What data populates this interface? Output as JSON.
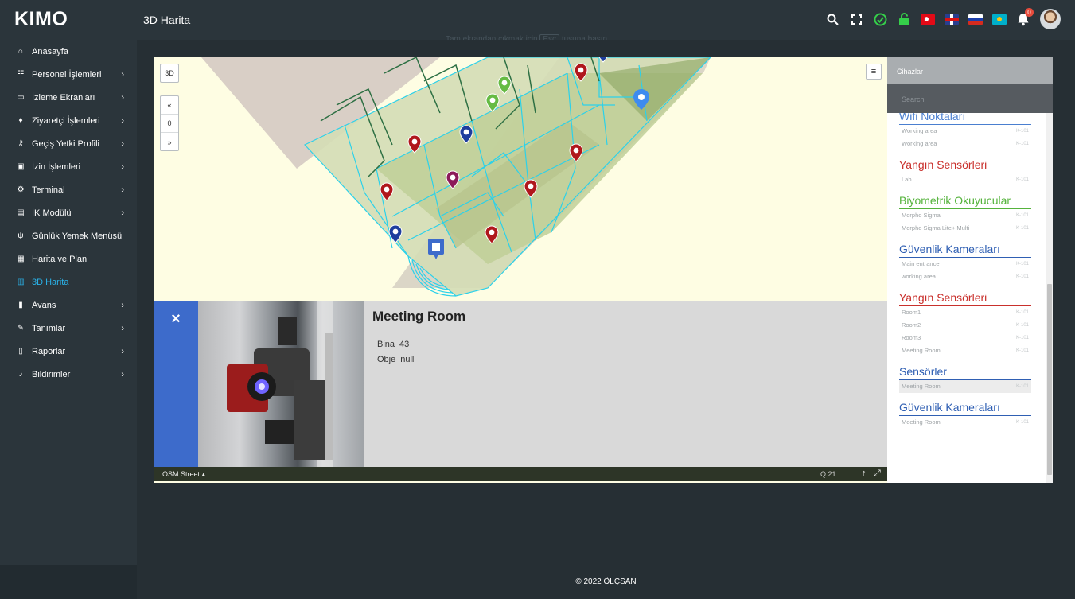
{
  "app": {
    "brand": "KIMO",
    "page_title": "3D Harita",
    "esc_hint_pre": "Tam ekrandan çıkmak için",
    "esc_key": "Esc",
    "esc_hint_post": "tuşuna basın"
  },
  "header_icons": [
    "search-icon",
    "fullscreen-icon",
    "status-ok-icon",
    "unlock-icon",
    "flag-tr",
    "flag-en",
    "flag-ru",
    "flag-kz",
    "bell-icon",
    "avatar"
  ],
  "notifications": {
    "count": "0"
  },
  "sidebar": {
    "items": [
      {
        "label": "Anasayfa",
        "icon": "home-icon"
      },
      {
        "label": "Personel İşlemleri",
        "icon": "users-icon",
        "arrow": "›"
      },
      {
        "label": "İzleme Ekranları",
        "icon": "monitor-icon",
        "arrow": "›"
      },
      {
        "label": "Ziyaretçi İşlemleri",
        "icon": "visitor-icon",
        "arrow": "›"
      },
      {
        "label": "Geçiş Yetki Profili",
        "icon": "key-icon",
        "arrow": "›"
      },
      {
        "label": "İzin İşlemleri",
        "icon": "calendar-icon",
        "arrow": "›"
      },
      {
        "label": "Terminal",
        "icon": "gear-icon",
        "arrow": "›"
      },
      {
        "label": "İK Modülü",
        "icon": "id-card-icon",
        "arrow": "›"
      },
      {
        "label": "Günlük Yemek Menüsü",
        "icon": "cutlery-icon"
      },
      {
        "label": "Harita ve Plan",
        "icon": "floorplan-icon"
      },
      {
        "label": "3D Harita",
        "icon": "map-icon"
      },
      {
        "label": "Avans",
        "icon": "bar-chart-icon",
        "arrow": "›"
      },
      {
        "label": "Tanımlar",
        "icon": "pencil-icon",
        "arrow": "›"
      },
      {
        "label": "Raporlar",
        "icon": "report-icon",
        "arrow": "›"
      },
      {
        "label": "Bildirimler",
        "icon": "bell-icon",
        "arrow": "›"
      }
    ]
  },
  "map": {
    "btn_3d": "3D",
    "btn_up": "«",
    "floor": "0",
    "btn_down": "»",
    "menu": "≡"
  },
  "info_panel": {
    "close": "×",
    "title": "Meeting Room",
    "rows": [
      {
        "key": "Bina",
        "value": "43"
      },
      {
        "key": "Obje",
        "value": "null"
      }
    ]
  },
  "status_bar": {
    "layer": "OSM Street ▴",
    "zoom": "Q 21",
    "north": "↑",
    "expand": "⤢"
  },
  "devices": {
    "header": "Cihazlar",
    "search_placeholder": "Search",
    "groups": [
      {
        "title": "Wifi Noktaları",
        "color": "#4a7fd0",
        "items": [
          {
            "name": "Working area",
            "code": "K-101"
          },
          {
            "name": "Working area",
            "code": "K-101"
          }
        ]
      },
      {
        "title": "Yangın Sensörleri",
        "color": "#c9302c",
        "items": [
          {
            "name": "Lab",
            "code": "K-101"
          }
        ]
      },
      {
        "title": "Biyometrik Okuyucular",
        "color": "#55b33c",
        "items": [
          {
            "name": "Morpho Sigma",
            "code": "K-101"
          },
          {
            "name": "Morpho Sigma Lite+ Multi",
            "code": "K-101"
          }
        ]
      },
      {
        "title": "Güvenlik Kameraları",
        "color": "#2f5fb3",
        "items": [
          {
            "name": "Main entrance",
            "code": "K-101"
          },
          {
            "name": "working area",
            "code": "K-101"
          }
        ]
      },
      {
        "title": "Yangın Sensörleri",
        "color": "#c9302c",
        "items": [
          {
            "name": "Room1",
            "code": "K-101"
          },
          {
            "name": "Room2",
            "code": "K-101"
          },
          {
            "name": "Room3",
            "code": "K-101"
          },
          {
            "name": "Meeting Room",
            "code": "K-101"
          }
        ]
      },
      {
        "title": "Sensörler",
        "color": "#2f5fb3",
        "items": [
          {
            "name": "Meeting Room",
            "code": "K-101",
            "selected": true
          }
        ]
      },
      {
        "title": "Güvenlik Kameraları",
        "color": "#2f5fb3",
        "items": [
          {
            "name": "Meeting Room",
            "code": "K-101"
          }
        ]
      }
    ]
  },
  "footer": {
    "text": "© 2022 ÖLÇSAN"
  }
}
